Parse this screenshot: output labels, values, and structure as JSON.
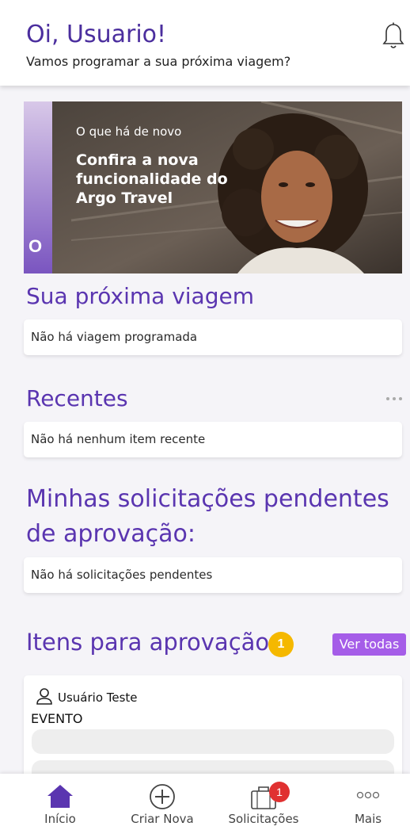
{
  "header": {
    "greeting": "Oi, Usuario!",
    "subtitle": "Vamos programar a sua próxima viagem?",
    "bell_icon": "bell-icon"
  },
  "banner": {
    "kicker": "O que há de novo",
    "title": "Confira a nova funcionalidade do Argo Travel",
    "side_text": "O"
  },
  "next_trip": {
    "title": "Sua próxima viagem",
    "empty_text": "Não há viagem programada"
  },
  "recents": {
    "title": "Recentes",
    "empty_text": "Não há nenhum item recente"
  },
  "pending": {
    "title": "Minhas solicitações pendentes de aprovação:",
    "empty_text": "Não há solicitações pendentes"
  },
  "approval": {
    "title": "Itens para aprovação",
    "count": "1",
    "view_all_label": "Ver todas",
    "item": {
      "user": "Usuário Teste",
      "type": "EVENTO"
    }
  },
  "bottom_nav": {
    "items": [
      {
        "label": "Início",
        "icon": "home-icon",
        "active": true
      },
      {
        "label": "Criar Nova",
        "icon": "plus-circle-icon"
      },
      {
        "label": "Solicitações",
        "icon": "briefcase-icon",
        "badge": "1"
      },
      {
        "label": "Mais",
        "icon": "more-dots-icon"
      }
    ]
  },
  "colors": {
    "primary_purple": "#5a35b0",
    "accent_purple": "#a55de8",
    "badge_yellow": "#f5b800",
    "badge_red": "#e03131",
    "background": "#f5f4f8"
  }
}
